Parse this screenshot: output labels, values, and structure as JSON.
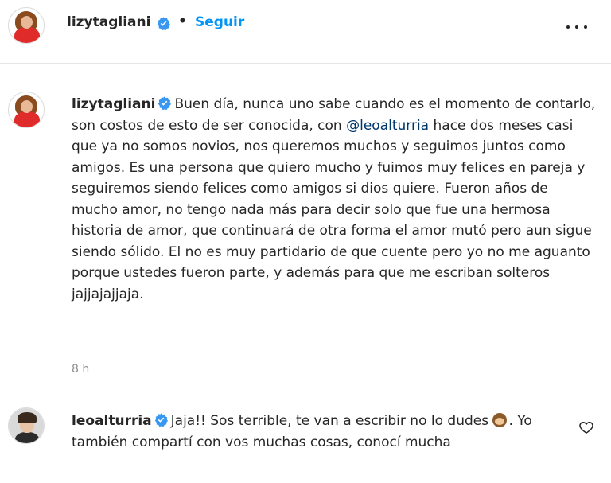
{
  "header": {
    "username": "lizytagliani",
    "separator": "•",
    "follow_label": "Seguir"
  },
  "post": {
    "username": "lizytagliani",
    "caption_part1": "Buen día, nunca uno sabe cuando es el momento de contarlo, son costos de esto de ser conocida, con ",
    "mention": "@leoalturria",
    "caption_part2": " hace dos meses casi que ya no somos novios, nos queremos muchos y seguimos juntos como amigos. Es una persona que quiero mucho y fuimos muy felices en pareja y seguiremos siendo felices como amigos si dios quiere. Fueron años de mucho amor, no tengo nada más para decir solo que fue una hermosa historia de amor, que continuará de otra forma el amor mutó pero aun sigue siendo sólido. El no es muy partidario de que cuente pero yo no me aguanto porque ustedes fueron parte, y además para que me escriban solteros jajjajajjaja.",
    "timestamp": "8 h"
  },
  "comment": {
    "username": "leoalturria",
    "text_part1": "Jaja!! Sos terrible, te van a escribir no lo dudes ",
    "text_part2": ". Yo también compartí con vos muchas cosas, conocí mucha"
  },
  "icons": {
    "verified": "verified-badge-icon",
    "more": "more-options-icon",
    "heart": "heart-icon",
    "emoji": "see-no-evil-monkey-emoji"
  },
  "colors": {
    "link_blue": "#0095f6",
    "mention": "#00376b",
    "verified": "#3897f0",
    "muted": "#8e8e8e"
  }
}
